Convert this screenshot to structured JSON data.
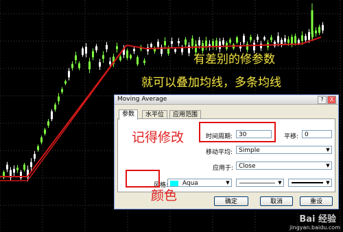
{
  "annotations": {
    "line1": "有差别的修参数",
    "line2": "就可以叠加均线，多条均线",
    "modify_note": "记得修改",
    "color_note": "颜色"
  },
  "dialog": {
    "title": "Moving Average",
    "help_btn": "?",
    "close_btn": "X",
    "tabs": [
      "参数",
      "水平位",
      "应用范围"
    ],
    "period_label": "时间周期:",
    "period_value": "30",
    "shift_label": "平移:",
    "shift_value": "0",
    "ma_method_label": "移动平均:",
    "ma_method_value": "Simple",
    "apply_label": "应用于:",
    "apply_value": "Close",
    "style_label": "风格:",
    "style_color_name": "Aqua",
    "style_color": "#00ffff",
    "ok_label": "确定",
    "cancel_label": "取消",
    "reset_label": "重设"
  },
  "colors": {
    "chart_bg": "#000000",
    "candle_up": "#7fff40",
    "candle_down": "#ffffff",
    "ma_line": "#d01818",
    "annotation_yellow": "#f5e642",
    "annotation_red": "#e02020"
  },
  "watermark": {
    "logo": "Bai 经验",
    "url": "jingyan.baidu.com"
  }
}
